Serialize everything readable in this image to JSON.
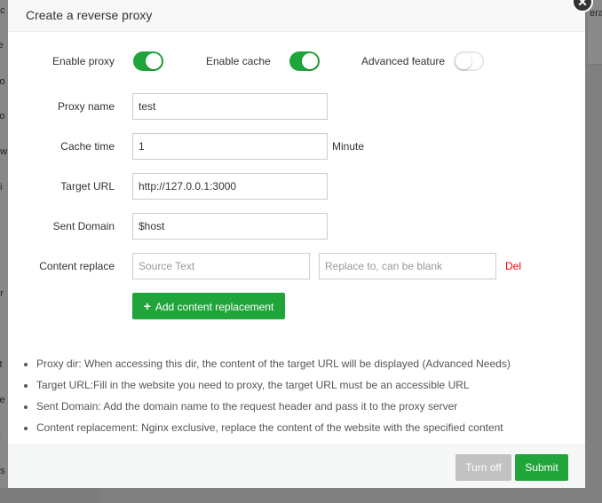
{
  "background": {
    "sidebar_fragments": [
      "ec",
      "re",
      "co",
      "co",
      "ow",
      "t i",
      "er",
      "e",
      "ct",
      "se",
      "F",
      "ns"
    ],
    "right_fragment": "era"
  },
  "dialog": {
    "title": "Create a reverse proxy",
    "close_symbol": "✕",
    "toggles": {
      "enable_proxy": {
        "label": "Enable proxy",
        "state": "on"
      },
      "enable_cache": {
        "label": "Enable cache",
        "state": "on"
      },
      "advanced_feature": {
        "label": "Advanced feature",
        "state": "off"
      }
    },
    "form": {
      "proxy_name": {
        "label": "Proxy name",
        "value": "test"
      },
      "cache_time": {
        "label": "Cache time",
        "value": "1",
        "unit": "Minute"
      },
      "target_url": {
        "label": "Target URL",
        "value": "http://127.0.0.1:3000"
      },
      "sent_domain": {
        "label": "Sent Domain",
        "value": "$host"
      },
      "content_replace": {
        "label": "Content replace",
        "source_placeholder": "Source Text",
        "replace_placeholder": "Replace to, can be blank",
        "delete_label": "Del"
      }
    },
    "add_button": {
      "icon": "+",
      "label": "Add content replacement"
    },
    "notes": [
      "Proxy dir: When accessing this dir, the content of the target URL will be displayed (Advanced Needs)",
      "Target URL:Fill in the website you need to proxy, the target URL must be an accessible URL",
      "Sent Domain: Add the domain name to the request header and pass it to the proxy server",
      "Content replacement: Nginx exclusive, replace the content of the website with the specified content"
    ],
    "footer": {
      "cancel_label": "Turn off",
      "submit_label": "Submit"
    }
  },
  "colors": {
    "accent": "#20a53a",
    "delete": "#ff0000",
    "disabled": "#c2c2c2"
  }
}
